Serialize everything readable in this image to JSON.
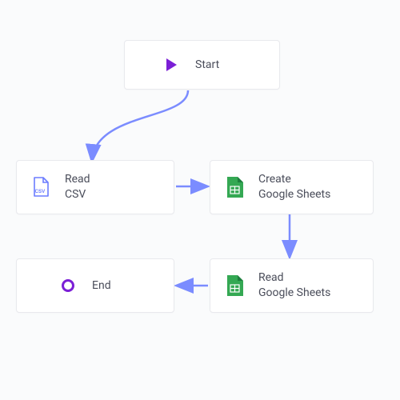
{
  "nodes": {
    "start": {
      "label": "Start"
    },
    "read_csv": {
      "label": "Read\nCSV"
    },
    "create_sheets": {
      "label": "Create\nGoogle Sheets"
    },
    "read_sheets": {
      "label": "Read\nGoogle Sheets"
    },
    "end": {
      "label": "End"
    }
  },
  "colors": {
    "arrow": "#7b8cff",
    "start_icon": "#7b1fd6",
    "csv_icon": "#6b7cff",
    "sheets_icon": "#34a853",
    "end_icon": "#7b1fd6"
  }
}
